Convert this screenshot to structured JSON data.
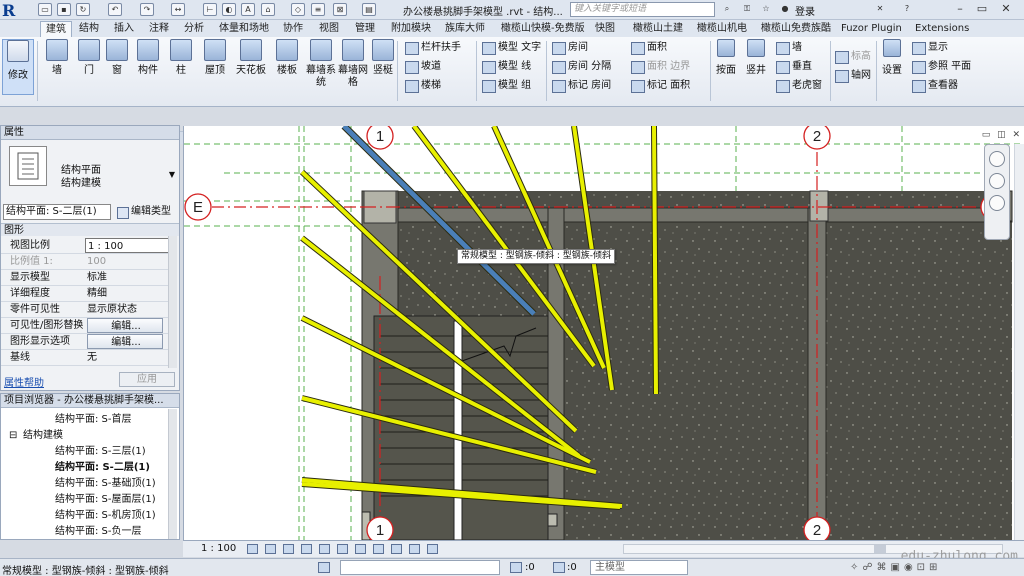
{
  "app": {
    "title": "办公楼悬挑脚手架模型 .rvt - 结构...",
    "search_placeholder": "键入关键字或短语",
    "login_label": "登录",
    "logo_letter": "R"
  },
  "ribbon": {
    "tabs": [
      "建筑",
      "结构",
      "插入",
      "注释",
      "分析",
      "体量和场地",
      "协作",
      "视图",
      "管理",
      "附加模块",
      "族库大师",
      "橄榄山快模-免费版",
      "快图",
      "橄榄山土建",
      "橄榄山机电",
      "橄榄山免费族酷",
      "Fuzor Plugin",
      "Extensions"
    ],
    "active_tab": "建筑",
    "modify_label": "修改",
    "build_buttons": [
      "墙",
      "门",
      "窗",
      "构件",
      "柱",
      "屋顶",
      "天花板",
      "楼板",
      "幕墙系统",
      "幕墙网格",
      "竖梃"
    ],
    "circulation": [
      "栏杆扶手",
      "坡道",
      "楼梯"
    ],
    "model": [
      "模型 文字",
      "模型 线",
      "模型 组"
    ],
    "room": [
      "房间",
      "房间 分隔",
      "标记 房间"
    ],
    "area": [
      "面积",
      "面积 边界",
      "标记 面积"
    ],
    "opening": [
      "按面",
      "竖井",
      "墙",
      "垂直",
      "老虎窗"
    ],
    "datum": [
      "标高",
      "轴网"
    ],
    "workplane": [
      "设置",
      "显示",
      "参照 平面",
      "查看器"
    ]
  },
  "properties": {
    "panel_title": "属性",
    "type_line1": "结构平面",
    "type_line2": "结构建模",
    "view_selector": "结构平面: S-二层(1)",
    "edit_type_label": "编辑类型",
    "section_label": "图形",
    "rows": [
      {
        "key": "视图比例",
        "value": "1 : 100",
        "style": "boxed"
      },
      {
        "key": "比例值 1:",
        "value": "100",
        "style": "grey"
      },
      {
        "key": "显示模型",
        "value": "标准",
        "style": "plain"
      },
      {
        "key": "详细程度",
        "value": "精细",
        "style": "plain"
      },
      {
        "key": "零件可见性",
        "value": "显示原状态",
        "style": "plain"
      },
      {
        "key": "可见性/图形替换",
        "value": "编辑...",
        "style": "btn"
      },
      {
        "key": "图形显示选项",
        "value": "编辑...",
        "style": "btn"
      },
      {
        "key": "基线",
        "value": "无",
        "style": "plain"
      }
    ],
    "help_link": "属性帮助",
    "apply_label": "应用"
  },
  "browser": {
    "title": "项目浏览器 - 办公楼悬挑脚手架模...",
    "items": [
      {
        "label": "结构平面: S-首层",
        "indent": 2,
        "bold": false
      },
      {
        "label": "结构建模",
        "indent": 1,
        "bold": false,
        "toggle": "⊟"
      },
      {
        "label": "结构平面: S-三层(1)",
        "indent": 2,
        "bold": false
      },
      {
        "label": "结构平面: S-二层(1)",
        "indent": 2,
        "bold": true
      },
      {
        "label": "结构平面: S-基础顶(1)",
        "indent": 2,
        "bold": false
      },
      {
        "label": "结构平面: S-屋面层(1)",
        "indent": 2,
        "bold": false
      },
      {
        "label": "结构平面: S-机房顶(1)",
        "indent": 2,
        "bold": false
      },
      {
        "label": "结构平面: S-负一层",
        "indent": 2,
        "bold": false
      }
    ]
  },
  "canvas": {
    "tooltip": "常规模型 : 型钢族-倾斜 : 型钢族-倾斜",
    "grid_labels": {
      "col1": "1",
      "col2": "2",
      "rowE": "E"
    },
    "colors": {
      "beam": "#e8f000",
      "beam_outline": "#2b2b10",
      "slab": "#4d4d45",
      "grid": "#d42020",
      "selected": "#3d6fa8"
    }
  },
  "viewbar": {
    "scale": "1 : 100"
  },
  "status": {
    "text": "常规模型 : 型钢族-倾斜 : 型钢族-倾斜",
    "zero1": ":0",
    "zero2": ":0",
    "model": "主模型"
  },
  "watermark": "edu-zhulong.com"
}
